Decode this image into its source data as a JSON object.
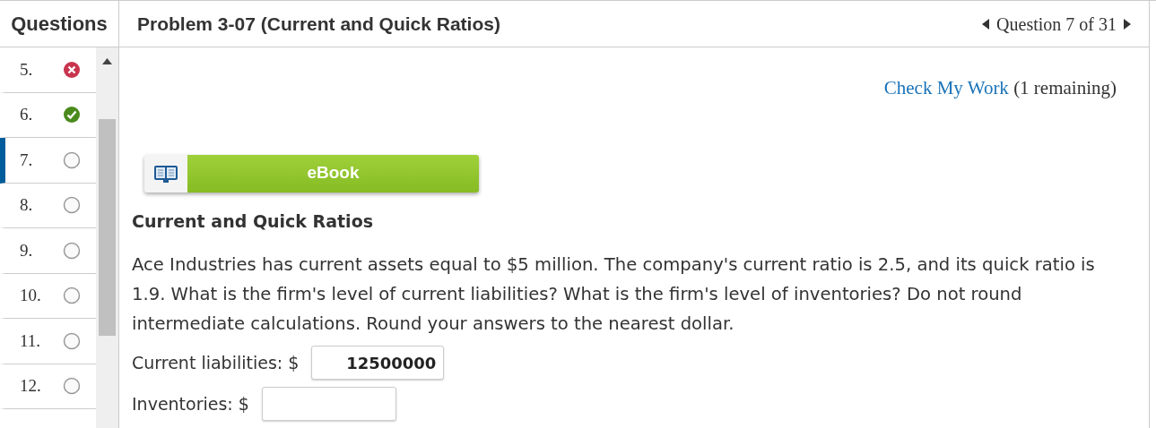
{
  "sidebar": {
    "title": "Questions",
    "items": [
      {
        "number": "5.",
        "kind": "wrong",
        "selected": false
      },
      {
        "number": "6.",
        "kind": "correct",
        "selected": false
      },
      {
        "number": "7.",
        "kind": "unanswered",
        "selected": true
      },
      {
        "number": "8.",
        "kind": "unanswered",
        "selected": false
      },
      {
        "number": "9.",
        "kind": "unanswered",
        "selected": false
      },
      {
        "number": "10.",
        "kind": "unanswered",
        "selected": false
      },
      {
        "number": "11.",
        "kind": "unanswered",
        "selected": false
      },
      {
        "number": "12.",
        "kind": "unanswered",
        "selected": false
      }
    ]
  },
  "header": {
    "title": "Problem 3-07 (Current and Quick Ratios)",
    "position": "Question 7 of 31"
  },
  "check_work": {
    "link": "Check My Work",
    "remaining": "(1 remaining)"
  },
  "ebook_button": "eBook",
  "problem": {
    "heading": "Current and Quick Ratios",
    "text": "Ace Industries has current assets equal to $5 million. The company's current ratio is 2.5, and its quick ratio is 1.9. What is the firm's level of current liabilities? What is the firm's level of inventories? Do not round intermediate calculations. Round your answers to the nearest dollar.",
    "fields": [
      {
        "label": "Current liabilities: $",
        "value": "12500000"
      },
      {
        "label": "Inventories: $"
      }
    ]
  }
}
